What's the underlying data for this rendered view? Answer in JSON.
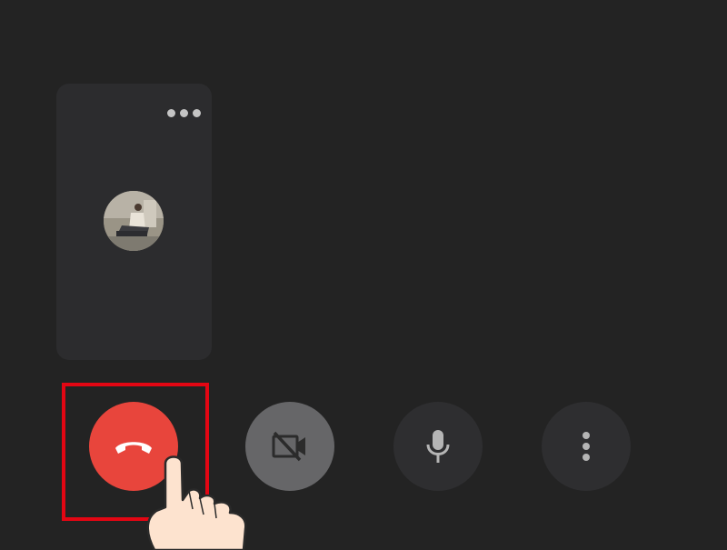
{
  "participant_tile": {
    "menu_icon": "more-horizontal-icon",
    "avatar_icon": "participant-avatar"
  },
  "controls": {
    "end_call": {
      "icon": "phone-hangup-icon",
      "color": "#e8453c"
    },
    "camera": {
      "icon": "video-off-icon",
      "color": "#666668"
    },
    "microphone": {
      "icon": "mic-icon",
      "color": "#2e2e30"
    },
    "more": {
      "icon": "more-vertical-icon",
      "color": "#2e2e30"
    }
  },
  "annotation": {
    "highlight_color": "#e30613",
    "pointer_icon": "tap-hand-icon"
  }
}
